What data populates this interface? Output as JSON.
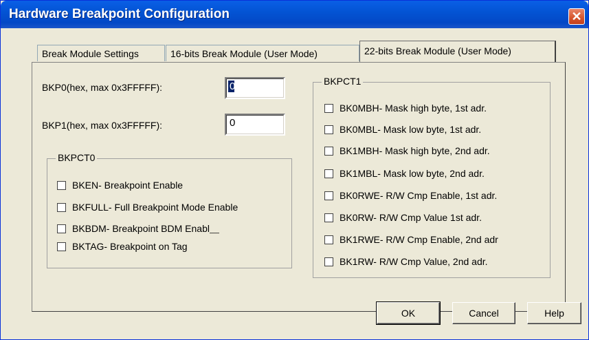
{
  "window": {
    "title": "Hardware Breakpoint Configuration",
    "close_glyph": "✕"
  },
  "tabs": [
    {
      "label": "Break Module Settings",
      "active": false
    },
    {
      "label": "16-bits Break Module (User Mode)",
      "active": false
    },
    {
      "label": "22-bits Break Module (User Mode)",
      "active": true
    }
  ],
  "fields": {
    "bkp0": {
      "label": "BKP0(hex, max 0x3FFFFF):",
      "value": "0"
    },
    "bkp1": {
      "label": "BKP1(hex, max 0x3FFFFF):",
      "value": "0"
    }
  },
  "bkpct0": {
    "title": "BKPCT0",
    "items": [
      {
        "label": "BKEN- Breakpoint Enable",
        "checked": false
      },
      {
        "label": "BKFULL- Full Breakpoint Mode Enable",
        "checked": false
      },
      {
        "label": "BKBDM- Breakpoint BDM Enabl⸏",
        "checked": false
      },
      {
        "label": "BKTAG- Breakpoint on Tag",
        "checked": false
      }
    ]
  },
  "bkpct1": {
    "title": "BKPCT1",
    "items": [
      {
        "label": "BK0MBH- Mask high byte, 1st adr.",
        "checked": false
      },
      {
        "label": "BK0MBL- Mask low byte, 1st adr.",
        "checked": false
      },
      {
        "label": "BK1MBH- Mask high byte, 2nd adr.",
        "checked": false
      },
      {
        "label": "BK1MBL- Mask low byte, 2nd adr.",
        "checked": false
      },
      {
        "label": "BK0RWE- R/W Cmp Enable, 1st adr.",
        "checked": false
      },
      {
        "label": "BK0RW- R/W Cmp Value 1st adr.",
        "checked": false
      },
      {
        "label": "BK1RWE- R/W Cmp Enable, 2nd adr",
        "checked": false
      },
      {
        "label": "BK1RW- R/W Cmp Value, 2nd adr.",
        "checked": false
      }
    ]
  },
  "buttons": {
    "ok": "OK",
    "cancel": "Cancel",
    "help": "Help"
  },
  "colors": {
    "title_bar": "#0a5fe6",
    "dialog_bg": "#ece9d8",
    "close_button": "#d6552d"
  }
}
